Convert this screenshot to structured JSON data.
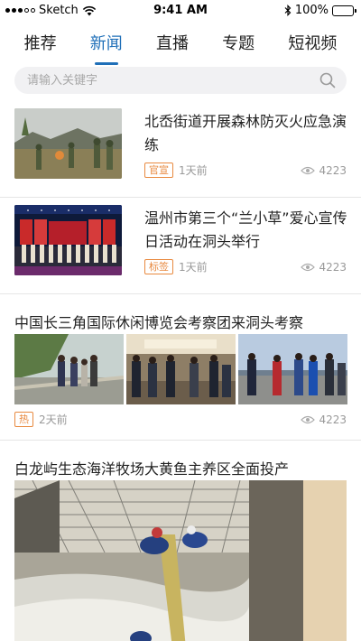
{
  "status_bar": {
    "carrier": "Sketch",
    "time": "9:41 AM",
    "battery": "100%"
  },
  "tabs": [
    {
      "label": "推荐",
      "active": false
    },
    {
      "label": "新闻",
      "active": true
    },
    {
      "label": "直播",
      "active": false
    },
    {
      "label": "专题",
      "active": false
    },
    {
      "label": "短视频",
      "active": false
    }
  ],
  "search": {
    "placeholder": "请输入关键字"
  },
  "news": [
    {
      "title": "北岙街道开展森林防灭火应急演练",
      "badge": "官宣",
      "time": "1天前",
      "views": "4223"
    },
    {
      "title": "温州市第三个“兰小草”爱心宣传日活动在洞头举行",
      "badge": "标签",
      "time": "1天前",
      "views": "4223"
    },
    {
      "title": "中国长三角国际休闲博览会考察团来洞头考察",
      "badge": "热",
      "time": "2天前",
      "views": "4223"
    },
    {
      "title": "白龙屿生态海洋牧场大黄鱼主养区全面投产"
    }
  ],
  "colors": {
    "accent": "#1f6fb8",
    "badge": "#e8893f"
  }
}
